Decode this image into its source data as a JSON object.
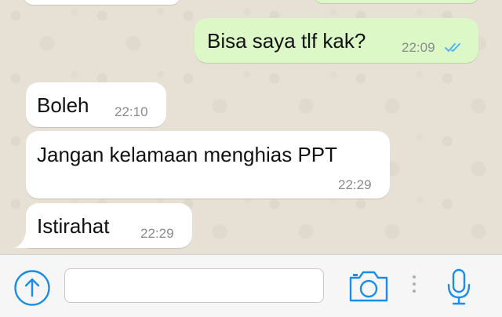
{
  "messages": [
    {
      "direction": "outgoing",
      "text": "Bisa saya tlf kak?",
      "time": "22:09",
      "status": "read-double-check-icon"
    },
    {
      "direction": "incoming",
      "text": "Boleh",
      "time": "22:10"
    },
    {
      "direction": "incoming",
      "text": "Jangan kelamaan menghias PPT",
      "time": "22:29"
    },
    {
      "direction": "incoming",
      "text": "Istirahat",
      "time": "22:29"
    }
  ],
  "input": {
    "placeholder": "",
    "value": ""
  },
  "icons": {
    "upload": "upload-arrow-icon",
    "camera": "camera-icon",
    "more": "more-dots-icon",
    "mic": "microphone-icon",
    "ticks": "double-check-icon"
  },
  "colors": {
    "outgoing_bubble": "#dcf8c6",
    "incoming_bubble": "#ffffff",
    "accent": "#1a8de6",
    "tick": "#4fb6ec",
    "wallpaper": "#e7e0d4"
  }
}
